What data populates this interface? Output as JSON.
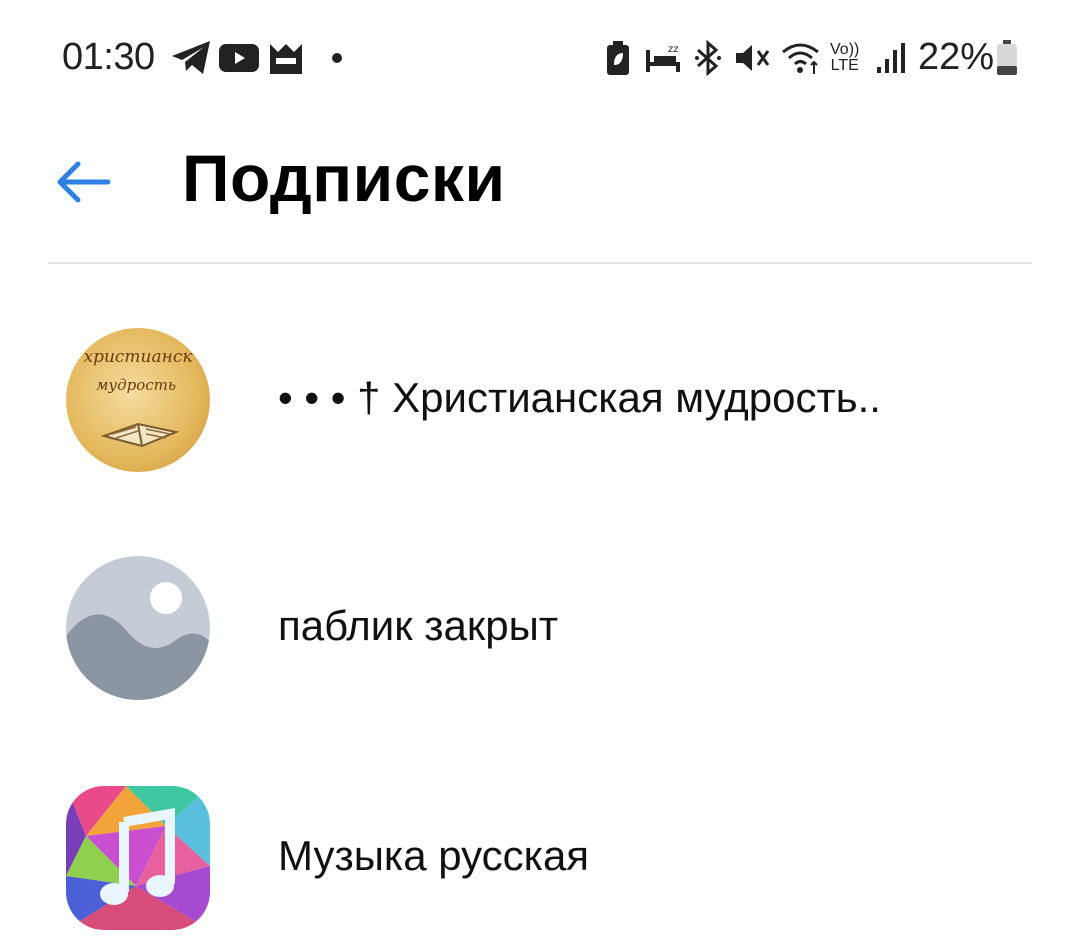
{
  "status_bar": {
    "time": "01:30",
    "battery_percent": "22%",
    "left_icons": [
      "telegram-icon",
      "youtube-icon",
      "mask-app-icon",
      "notification-dot-icon"
    ],
    "right_icons": [
      "battery-saver-icon",
      "sleep-mode-icon",
      "bluetooth-icon",
      "mute-icon",
      "wifi-icon",
      "volte-icon",
      "signal-icon",
      "battery-icon"
    ],
    "volte_label_top": "Vo))",
    "volte_label_bottom": "LTE"
  },
  "header": {
    "title": "Подписки",
    "back_icon": "arrow-left-icon"
  },
  "subscriptions": [
    {
      "label": "• • • † Христианская мудрость..",
      "avatar_icon": "book-avatar",
      "avatar_text_line1": "христианск",
      "avatar_text_line2": "мудрость"
    },
    {
      "label": "паблик закрыт",
      "avatar_icon": "placeholder-image-avatar"
    },
    {
      "label": "Музыка русская",
      "avatar_icon": "music-note-avatar"
    }
  ],
  "colors": {
    "accent": "#2d81e0",
    "divider": "#e4e6ea",
    "placeholder_bg": "#c5ccd6",
    "placeholder_wave": "#8c96a3"
  }
}
